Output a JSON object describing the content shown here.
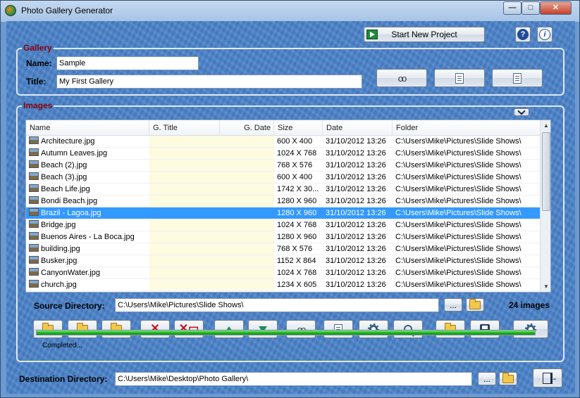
{
  "window": {
    "title": "Photo Gallery Generator"
  },
  "header": {
    "start_new_project_label": "Start New Project"
  },
  "gallery": {
    "group_label": "Gallery",
    "name_label": "Name:",
    "name_value": "Sample",
    "title_label": "Title:",
    "title_value": "My First Gallery"
  },
  "images": {
    "group_label": "Images",
    "columns": [
      "Name",
      "G. Title",
      "G. Date",
      "Size",
      "Date",
      "Folder"
    ],
    "rows": [
      {
        "name": "Architecture.jpg",
        "g_title": "",
        "g_date": "",
        "size": "600 X 400",
        "date": "31/10/2012 13:26",
        "folder": "C:\\Users\\Mike\\Pictures\\Slide Shows\\"
      },
      {
        "name": "Autumn Leaves.jpg",
        "g_title": "",
        "g_date": "",
        "size": "1024 X 768",
        "date": "31/10/2012 13:26",
        "folder": "C:\\Users\\Mike\\Pictures\\Slide Shows\\"
      },
      {
        "name": "Beach (2).jpg",
        "g_title": "",
        "g_date": "",
        "size": "768 X 576",
        "date": "31/10/2012 13:26",
        "folder": "C:\\Users\\Mike\\Pictures\\Slide Shows\\"
      },
      {
        "name": "Beach (3).jpg",
        "g_title": "",
        "g_date": "",
        "size": "600 X 400",
        "date": "31/10/2012 13:26",
        "folder": "C:\\Users\\Mike\\Pictures\\Slide Shows\\"
      },
      {
        "name": "Beach Life.jpg",
        "g_title": "",
        "g_date": "",
        "size": "1742 X 30...",
        "date": "31/10/2012 13:26",
        "folder": "C:\\Users\\Mike\\Pictures\\Slide Shows\\"
      },
      {
        "name": "Bondi Beach.jpg",
        "g_title": "",
        "g_date": "",
        "size": "1280 X 960",
        "date": "31/10/2012 13:26",
        "folder": "C:\\Users\\Mike\\Pictures\\Slide Shows\\"
      },
      {
        "name": "Brazil - Lagoa.jpg",
        "g_title": "",
        "g_date": "",
        "size": "1280 X 960",
        "date": "31/10/2012 13:26",
        "folder": "C:\\Users\\Mike\\Pictures\\Slide Shows\\",
        "selected": true
      },
      {
        "name": "Bridge.jpg",
        "g_title": "",
        "g_date": "",
        "size": "1024 X 768",
        "date": "31/10/2012 13:26",
        "folder": "C:\\Users\\Mike\\Pictures\\Slide Shows\\"
      },
      {
        "name": "Buenos Aires - La Boca.jpg",
        "g_title": "",
        "g_date": "",
        "size": "1280 X 960",
        "date": "31/10/2012 13:26",
        "folder": "C:\\Users\\Mike\\Pictures\\Slide Shows\\"
      },
      {
        "name": "building.jpg",
        "g_title": "",
        "g_date": "",
        "size": "768 X 576",
        "date": "31/10/2012 13:26",
        "folder": "C:\\Users\\Mike\\Pictures\\Slide Shows\\"
      },
      {
        "name": "Busker.jpg",
        "g_title": "",
        "g_date": "",
        "size": "1152 X 864",
        "date": "31/10/2012 13:26",
        "folder": "C:\\Users\\Mike\\Pictures\\Slide Shows\\"
      },
      {
        "name": "CanyonWater.jpg",
        "g_title": "",
        "g_date": "",
        "size": "1024 X 768",
        "date": "31/10/2012 13:26",
        "folder": "C:\\Users\\Mike\\Pictures\\Slide Shows\\"
      },
      {
        "name": "church.jpg",
        "g_title": "",
        "g_date": "",
        "size": "1234 X 605",
        "date": "31/10/2012 13:26",
        "folder": "C:\\Users\\Mike\\Pictures\\Slide Shows\\"
      }
    ],
    "source_directory_label": "Source Directory:",
    "source_directory_value": "C:\\Users\\Mike\\Pictures\\Slide Shows\\",
    "browse_label": "...",
    "image_count": "24 images",
    "status_text": "Completed...",
    "progress": 1.0
  },
  "destination": {
    "label": "Destination Directory:",
    "value": "C:\\Users\\Mike\\Desktop\\Photo Gallery\\",
    "browse_label": "..."
  },
  "colors": {
    "selection": "#3399ff",
    "group_label": "#8b0000",
    "progress": "#1bb11b"
  }
}
